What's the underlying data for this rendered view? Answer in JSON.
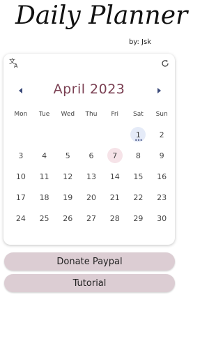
{
  "header": {
    "title": "Daily Planner",
    "subtitle": "by: Jsk"
  },
  "calendar": {
    "month_title": "April 2023",
    "weekdays": [
      "Mon",
      "Tue",
      "Wed",
      "Thu",
      "Fri",
      "Sat",
      "Sun"
    ],
    "days": [
      {
        "n": "",
        "state": "blank"
      },
      {
        "n": "",
        "state": "blank"
      },
      {
        "n": "",
        "state": "blank"
      },
      {
        "n": "",
        "state": "blank"
      },
      {
        "n": "",
        "state": "blank"
      },
      {
        "n": "1",
        "state": "selected",
        "marker": "•••"
      },
      {
        "n": "2",
        "state": "normal"
      },
      {
        "n": "3",
        "state": "normal"
      },
      {
        "n": "4",
        "state": "normal"
      },
      {
        "n": "5",
        "state": "normal"
      },
      {
        "n": "6",
        "state": "normal"
      },
      {
        "n": "7",
        "state": "today"
      },
      {
        "n": "8",
        "state": "normal"
      },
      {
        "n": "9",
        "state": "normal"
      },
      {
        "n": "10",
        "state": "normal"
      },
      {
        "n": "11",
        "state": "normal"
      },
      {
        "n": "12",
        "state": "normal"
      },
      {
        "n": "13",
        "state": "normal"
      },
      {
        "n": "14",
        "state": "normal"
      },
      {
        "n": "15",
        "state": "normal"
      },
      {
        "n": "16",
        "state": "normal"
      },
      {
        "n": "17",
        "state": "normal"
      },
      {
        "n": "18",
        "state": "normal"
      },
      {
        "n": "19",
        "state": "normal"
      },
      {
        "n": "20",
        "state": "normal"
      },
      {
        "n": "21",
        "state": "normal"
      },
      {
        "n": "22",
        "state": "normal"
      },
      {
        "n": "23",
        "state": "normal"
      },
      {
        "n": "24",
        "state": "normal"
      },
      {
        "n": "25",
        "state": "normal"
      },
      {
        "n": "26",
        "state": "normal"
      },
      {
        "n": "27",
        "state": "normal"
      },
      {
        "n": "28",
        "state": "normal"
      },
      {
        "n": "29",
        "state": "normal"
      },
      {
        "n": "30",
        "state": "normal"
      }
    ],
    "icons": {
      "translate": "translate-icon",
      "refresh": "refresh-icon",
      "prev": "chevron-left-icon",
      "next": "chevron-right-icon"
    }
  },
  "buttons": {
    "donate_label": "Donate Paypal",
    "tutorial_label": "Tutorial"
  },
  "colors": {
    "accent": "#7a3f52",
    "button_bg": "#dccdd3",
    "today_bg": "#f6e3e8",
    "selected_bg": "#e5ebf8",
    "nav_arrow": "#3b4a7a"
  }
}
